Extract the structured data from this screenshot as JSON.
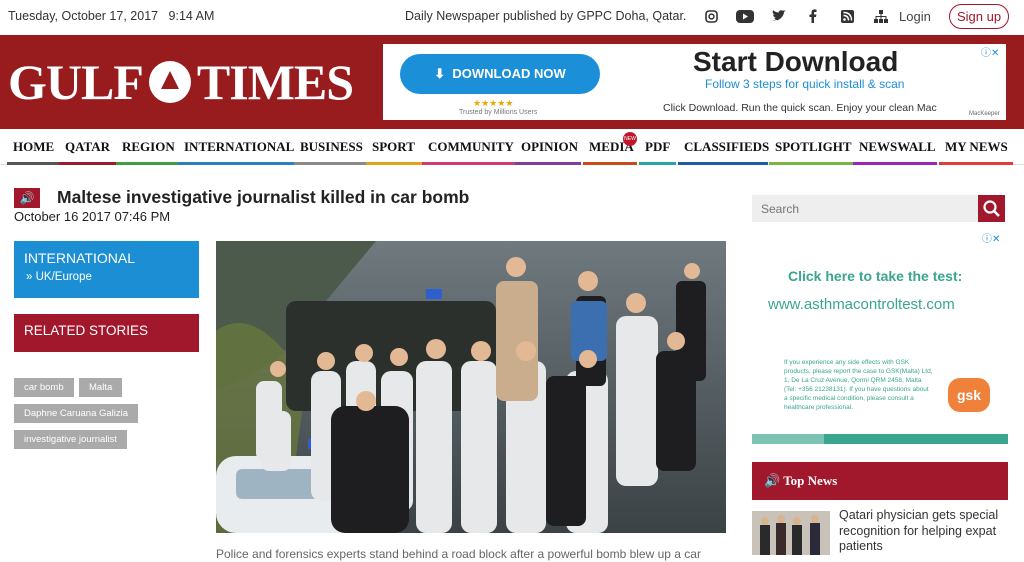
{
  "topbar": {
    "date": "Tuesday, October 17, 2017",
    "time": "9:14 AM",
    "tagline": "Daily Newspaper published by GPPC Doha, Qatar.",
    "social_icons": [
      "instagram-icon",
      "youtube-icon",
      "twitter-icon",
      "facebook-icon",
      "rss-icon",
      "sitemap-icon"
    ],
    "login": "Login",
    "signup": "Sign up"
  },
  "brand": {
    "name_left": "GULF",
    "name_right": "TIMES"
  },
  "ad_top": {
    "button": "DOWNLOAD NOW",
    "rating": "★★★★★",
    "trusted": "Trusted by Millions Users",
    "headline": "Start Download",
    "subhead": "Follow 3 steps for quick install & scan",
    "body": "Click Download. Run the quick scan. Enjoy your clean Mac",
    "sponsor": "MacKeeper"
  },
  "nav": {
    "items": [
      "HOME",
      "QATAR",
      "REGION",
      "INTERNATIONAL",
      "BUSINESS",
      "SPORT",
      "COMMUNITY",
      "OPINION",
      "MEDIA",
      "PDF",
      "CLASSIFIEDS",
      "SPOTLIGHT",
      "NEWSWALL",
      "MY NEWS"
    ],
    "bar_colors": [
      "#555555",
      "#9b1b30",
      "#3f9f3f",
      "#2f7fc0",
      "#8a8a8a",
      "#e0a21b",
      "#d63a6a",
      "#7a3fa0",
      "#c84a1a",
      "#2aa3a3",
      "#1e5aa8",
      "#7cb342",
      "#9c27b0",
      "#e53935"
    ],
    "media_badge": "NEW"
  },
  "article": {
    "headline": "Maltese investigative journalist killed in car bomb",
    "date": "October 16 2017 07:46 PM",
    "category": "INTERNATIONAL",
    "subcategory": "UK/Europe",
    "related_label": "RELATED STORIES",
    "tags": [
      "car bomb",
      "Malta",
      "Daphne Caruana Galizia",
      "investigative journalist"
    ],
    "caption": "Police and forensics experts stand behind a road block after a powerful bomb blew up a car"
  },
  "sidebar": {
    "search_placeholder": "Search",
    "ad": {
      "cta": "Click here to take the test:",
      "url": "www.asthmacontroltest.com",
      "fine_print": "If you experience any side effects with GSK products, please report the case to GSK(Malta) Ltd, 1, De La Cruz Avenue, Qormi QRM 2458, Malta (Tel: +356 21238131). If you have questions about a specific medical condition, please consult a healthcare professional.",
      "logo": "gsk"
    },
    "top_news_label": "Top News",
    "news_item": "Qatari physician gets special recognition for helping expat patients"
  },
  "colors": {
    "brand_red": "#981b1e",
    "accent_red": "#a1172c",
    "blue": "#1c8fd4",
    "ad_green": "#3aa690"
  }
}
